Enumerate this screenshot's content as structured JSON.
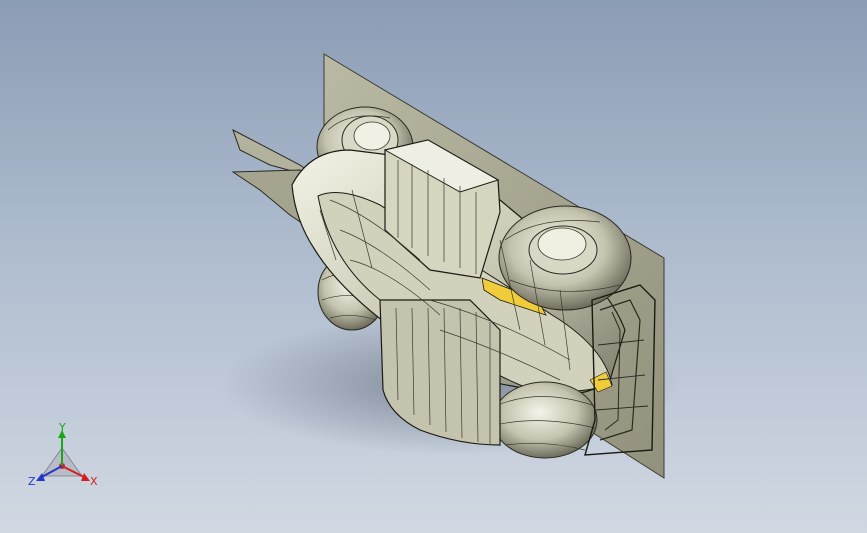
{
  "viewport": {
    "background_top": "#8b9cb5",
    "background_bottom": "#d1d8e2",
    "model_colors": {
      "surface_light": "#e6e6d6",
      "surface_mid": "#bdbca7",
      "surface_dark": "#6e6e5f",
      "edge": "#1a1a14",
      "accent_yellow": "#f0cc3a",
      "plane": "#a8a78f"
    }
  },
  "triad": {
    "x_label": "X",
    "y_label": "Y",
    "z_label": "Z",
    "x_color": "#d22020",
    "y_color": "#1aa81a",
    "z_color": "#2438c8"
  }
}
